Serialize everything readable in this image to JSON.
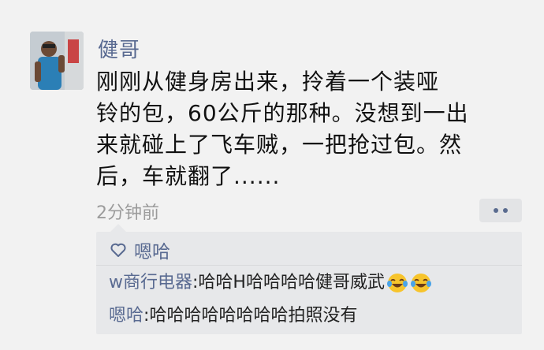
{
  "post": {
    "author": "健哥",
    "text": "刚刚从健身房出来，拎着一个装哑\n铃的包，60公斤的那种。没想到一出\n来就碰上了飞车贼，一把抢过包。然\n后，车就翻了......",
    "time": "2分钟前"
  },
  "likes": {
    "names": "嗯哈"
  },
  "comments": [
    {
      "author": "w商行电器",
      "separator": ": ",
      "text": "哈哈H哈哈哈哈健哥威武"
    },
    {
      "author": "嗯哈",
      "separator": ": ",
      "text": "哈哈哈哈哈哈哈哈拍照没有"
    }
  ],
  "colors": {
    "link": "#596a91",
    "background": "#f2f2f2",
    "box": "#e7e8ea"
  }
}
